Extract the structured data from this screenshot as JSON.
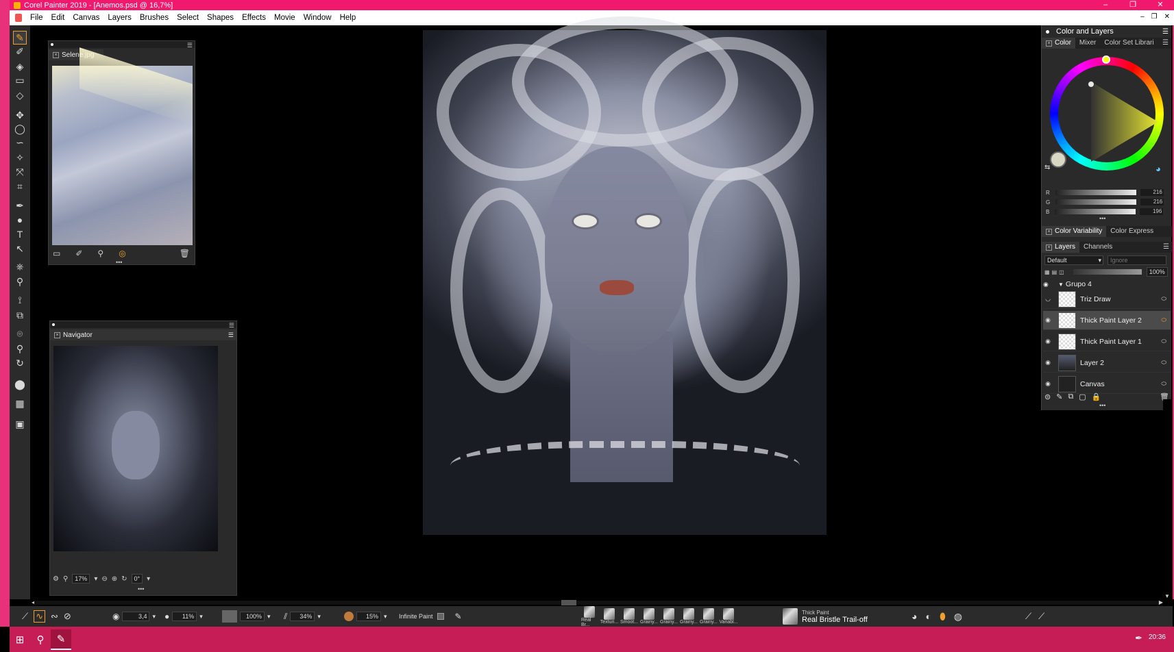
{
  "window": {
    "title": "Corel Painter 2019 - [Anemos.psd @ 16,7%]",
    "controls": [
      "–",
      "❐",
      "✕"
    ]
  },
  "menu": [
    "File",
    "Edit",
    "Canvas",
    "Layers",
    "Brushes",
    "Select",
    "Shapes",
    "Effects",
    "Movie",
    "Window",
    "Help"
  ],
  "document_controls": [
    "–",
    "❐",
    "✕"
  ],
  "toolbox": {
    "tools": [
      {
        "name": "brush-tool-icon",
        "glyph": "✎",
        "active": true
      },
      {
        "name": "dropper-tool-icon",
        "glyph": "✐"
      },
      {
        "name": "paint-bucket-tool-icon",
        "glyph": "◈"
      },
      {
        "name": "rectangle-fill-tool-icon",
        "glyph": "▭"
      },
      {
        "name": "eraser-tool-icon",
        "glyph": "◇"
      },
      {
        "name": "layer-adjuster-tool-icon",
        "glyph": "✥"
      },
      {
        "name": "oval-selection-tool-icon",
        "glyph": "◯"
      },
      {
        "name": "lasso-tool-icon",
        "glyph": "∽"
      },
      {
        "name": "magic-wand-tool-icon",
        "glyph": "✧"
      },
      {
        "name": "transform-tool-icon",
        "glyph": "⤧"
      },
      {
        "name": "crop-tool-icon",
        "glyph": "⌗"
      },
      {
        "name": "pen-tool-icon",
        "glyph": "✒"
      },
      {
        "name": "shape-tool-icon",
        "glyph": "●"
      },
      {
        "name": "text-tool-icon",
        "glyph": "T"
      },
      {
        "name": "shape-selection-tool-icon",
        "glyph": "↖"
      },
      {
        "name": "stamp-tool-icon",
        "glyph": "⎈"
      },
      {
        "name": "color-picker-tool-icon",
        "glyph": "⚲"
      },
      {
        "name": "perspective-tool-icon",
        "glyph": "⟟"
      },
      {
        "name": "mirror-tool-icon",
        "glyph": "⧉"
      },
      {
        "name": "kaleidoscope-tool-icon",
        "glyph": "⌾"
      },
      {
        "name": "magnifier-tool-icon",
        "glyph": "⚲"
      },
      {
        "name": "rotate-page-tool-icon",
        "glyph": "↻"
      },
      {
        "name": "main-color-swatch-icon",
        "glyph": "⬤"
      },
      {
        "name": "paper-texture-icon",
        "glyph": "▦"
      },
      {
        "name": "screen-mode-icon",
        "glyph": "▣"
      }
    ]
  },
  "reference_panel": {
    "tab": "Selene.jpg",
    "buttons": [
      "folder-icon",
      "dropper-icon",
      "magnify-icon",
      "lasso-icon",
      "trash-icon"
    ]
  },
  "navigator": {
    "tab": "Navigator",
    "zoom": "17%",
    "rotation": "0°"
  },
  "color_panel": {
    "title": "Color and Layers",
    "tabs": [
      "Color",
      "Mixer",
      "Color Set Librari"
    ],
    "rgb": [
      {
        "label": "R",
        "value": "216"
      },
      {
        "label": "G",
        "value": "216"
      },
      {
        "label": "B",
        "value": "196"
      }
    ],
    "current_color": "#d8d8c4",
    "variability_tabs": [
      "Color Variability",
      "Color Express"
    ]
  },
  "layers_panel": {
    "tabs": [
      "Layers",
      "Channels"
    ],
    "composite_method": "Default",
    "preserve": "Ignore",
    "opacity": "100%",
    "group": "Grupo 4",
    "layers": [
      {
        "name": "Triz Draw",
        "visible": "◡",
        "selected": false
      },
      {
        "name": "Thick Paint Layer 2",
        "visible": "◉",
        "selected": true
      },
      {
        "name": "Thick Paint Layer 1",
        "visible": "◉",
        "selected": false
      },
      {
        "name": "Layer 2",
        "visible": "◉",
        "selected": false
      },
      {
        "name": "Canvas",
        "visible": "◉",
        "selected": false
      }
    ]
  },
  "property_bar": {
    "size": "3,4",
    "opacity": "11%",
    "grain": "100%",
    "bleed": "34%",
    "resaturation": "15%",
    "infinite_paint": "Infinite Paint",
    "brushes": [
      "Real Br...",
      "Texturi...",
      "Smoot...",
      "Grainy...",
      "Grainy...",
      "Grainy...",
      "Grainy...",
      "Variabl..."
    ],
    "brush_category": "Thick Paint",
    "brush_variant": "Real Bristle Trail-off"
  },
  "taskbar": {
    "time": "20:36"
  }
}
